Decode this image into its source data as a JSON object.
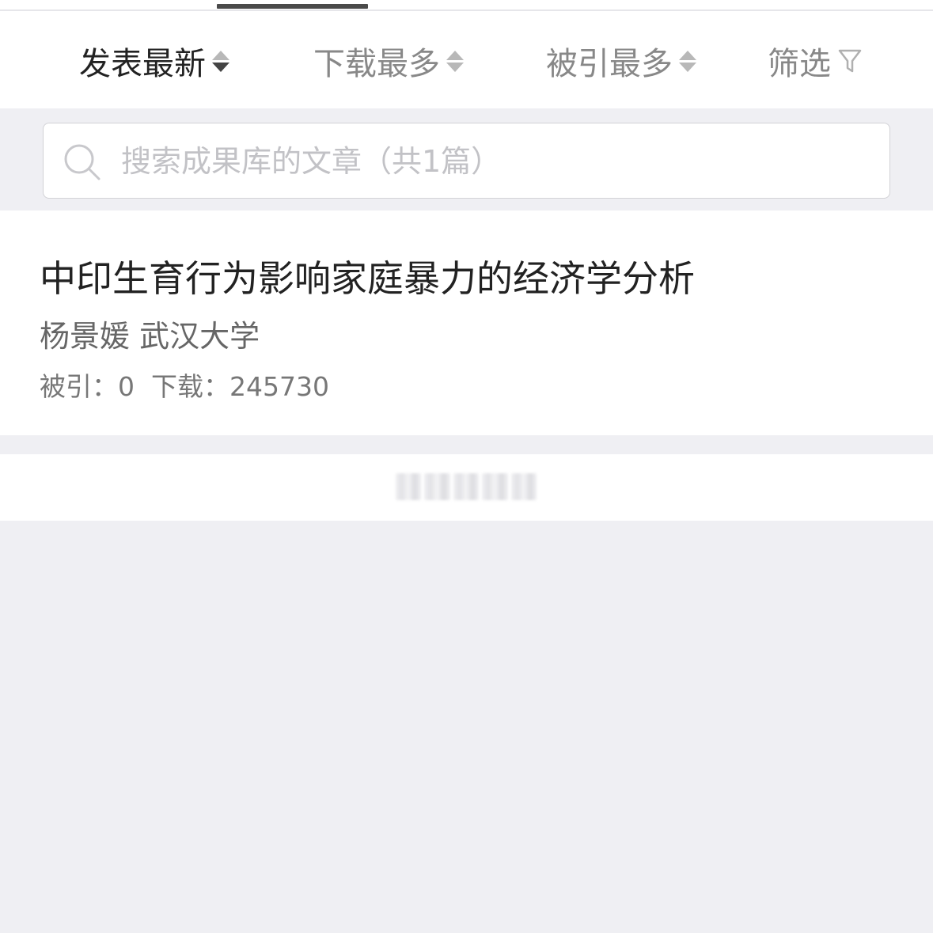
{
  "sort_bar": {
    "items": [
      {
        "label": "发表最新",
        "active": true
      },
      {
        "label": "下载最多",
        "active": false
      },
      {
        "label": "被引最多",
        "active": false
      }
    ],
    "filter_label": "筛选"
  },
  "search": {
    "placeholder": "搜索成果库的文章（共1篇）",
    "value": ""
  },
  "results": [
    {
      "title": "中印生育行为影响家庭暴力的经济学分析",
      "authors": "杨景媛 武汉大学",
      "cited_label": "被引：",
      "cited_value": "0",
      "download_label": "下载：",
      "download_value": "245730"
    }
  ],
  "icons": {
    "search": "search-icon",
    "filter": "filter-funnel-icon",
    "sort": "sort-arrows-icon"
  },
  "colors": {
    "active_text": "#222222",
    "inactive_text": "#888888",
    "background": "#efeff3",
    "tab_indicator": "#4a4a4a"
  }
}
